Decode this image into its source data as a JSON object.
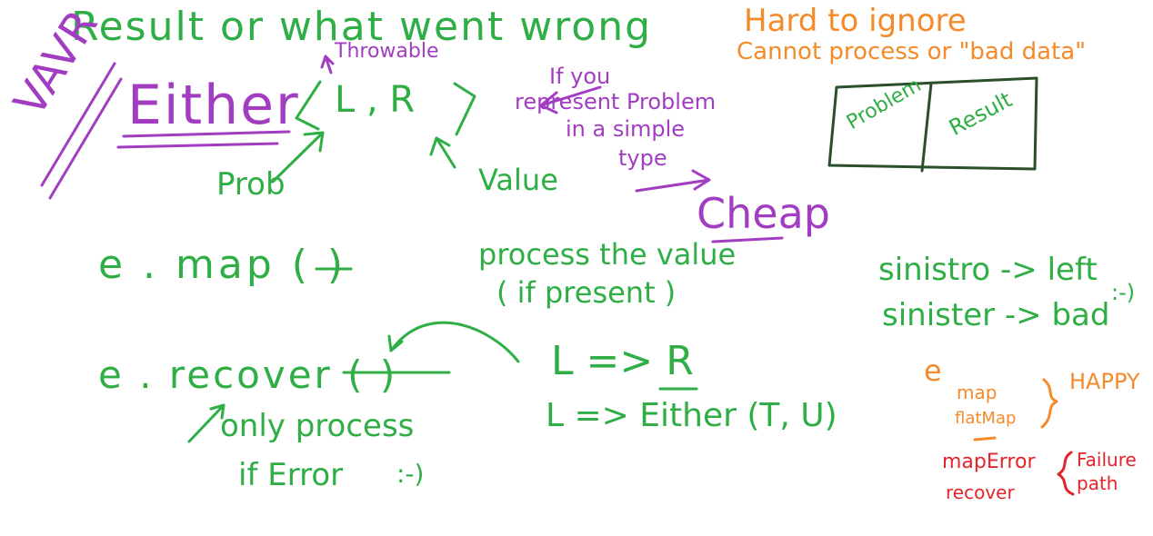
{
  "colors": {
    "green": "#2eae45",
    "purple": "#a23dc2",
    "orange": "#f48a2a",
    "red": "#e3242b",
    "box": "#2a4f2a"
  },
  "green": {
    "heading": "Result or what went wrong",
    "throwable": "Throwable",
    "type_params": "L , R",
    "problem": "Prob",
    "value": "Value",
    "map_call": "e . map (  )",
    "map_note_line1": "process the value",
    "map_note_line2": "( if present )",
    "recover_call": "e . recover (  )",
    "recover_note_line1": "only process",
    "recover_note_line2": "if Error",
    "smiley": ":-)",
    "rule1": "L => R",
    "rule2": "L => Either (T, U)",
    "sinistro": "sinistro -> left",
    "sinister": "sinister -> bad",
    "sinister_smiley": ":-)"
  },
  "purple": {
    "vavr": "VAVR",
    "either": "Either",
    "note_line1": "If you",
    "note_line2": "represent Problem",
    "note_line3": "in a simple",
    "note_line4": "type",
    "cheap": "Cheap"
  },
  "orange": {
    "hard_line1": "Hard to ignore",
    "hard_line2": "Cannot process or \"bad data\"",
    "e": "e",
    "map": "map",
    "flatmap": "flatMap",
    "happy": "HAPPY"
  },
  "red": {
    "map_error": "mapError",
    "recover": "recover",
    "failure_line1": "Failure",
    "failure_line2": "path"
  },
  "box": {
    "left": "Problem",
    "right": "Result"
  }
}
